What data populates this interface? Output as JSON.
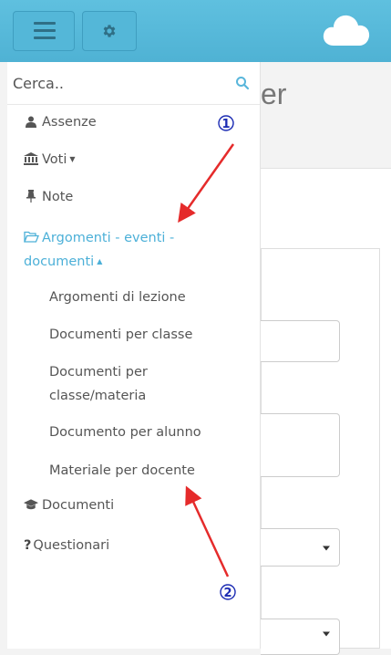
{
  "search": {
    "placeholder": "Cerca.."
  },
  "background": {
    "title_fragment": "er"
  },
  "sidebar": {
    "items": [
      {
        "label": "Assenze",
        "icon": "user-icon"
      },
      {
        "label": "Voti",
        "icon": "bank-icon"
      },
      {
        "label": "Note",
        "icon": "pin-icon"
      },
      {
        "label": "Argomenti - eventi - documenti",
        "icon": "folder-open-icon"
      },
      {
        "label": "Documenti",
        "icon": "graduation-cap-icon"
      },
      {
        "label": "Questionari",
        "icon": "question-icon"
      }
    ],
    "subitems": [
      {
        "label": "Argomenti di lezione"
      },
      {
        "label": "Documenti per classe"
      },
      {
        "label": "Documenti per classe/materia"
      },
      {
        "label": "Documento per alunno"
      },
      {
        "label": "Materiale per docente"
      }
    ]
  },
  "annotations": {
    "marker_1": "1",
    "marker_2": "2"
  },
  "colors": {
    "topbar": "#55b9da",
    "accent": "#4cb0d8",
    "annotation_arrow": "#e52b2b",
    "annotation_badge": "#1b2bb3"
  }
}
